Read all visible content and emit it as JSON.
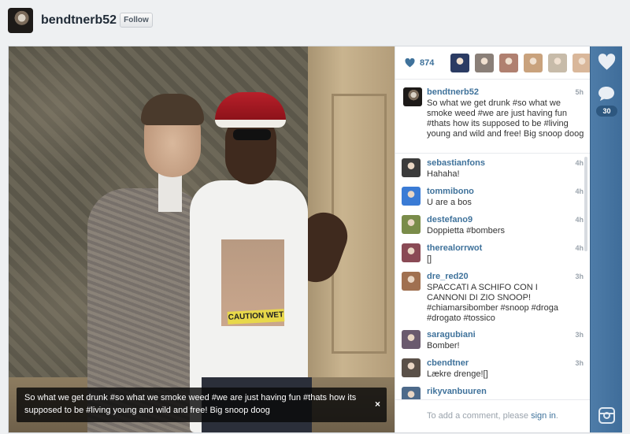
{
  "header": {
    "username": "bendtnerb52",
    "follow_label": "Follow"
  },
  "post": {
    "caption": "So what we get drunk #so what we smoke weed #we are just having fun #thats how its supposed to be #living young and wild and free! Big snoop doog",
    "photo_text": "CAUTION WET",
    "close_icon": "×"
  },
  "likes": {
    "count": "874",
    "avatar_colors": [
      "#2b3b63",
      "#8a7f78",
      "#b08070",
      "#c9a27d",
      "#c7bba9",
      "#d9b79a"
    ]
  },
  "author_comment": {
    "username": "bendtnerb52",
    "time": "5h",
    "text": "So what we get drunk #so what we smoke weed #we are just having fun #thats how its supposed to be #living young and wild and free! Big snoop doog"
  },
  "comments": [
    {
      "username": "sebastianfons",
      "time": "4h",
      "text": "Hahaha!",
      "color": "#3b3b3b"
    },
    {
      "username": "tommibono",
      "time": "4h",
      "text": "U are a bos",
      "color": "#3a7bd5"
    },
    {
      "username": "destefano9",
      "time": "4h",
      "text": "Doppietta #bombers",
      "color": "#7a8c4a"
    },
    {
      "username": "therealorrwot",
      "time": "4h",
      "text": "[]",
      "color": "#8a4a55"
    },
    {
      "username": "dre_red20",
      "time": "3h",
      "text": "SPACCATI A SCHIFO CON I CANNONI DI ZIO SNOOP! #chiamarsibomber #snoop #droga #drogato #tossico",
      "color": "#a07050"
    },
    {
      "username": "saragubiani",
      "time": "3h",
      "text": "Bomber!",
      "color": "#6a5a6e"
    },
    {
      "username": "cbendtner",
      "time": "3h",
      "text": "Lækre drenge![]",
      "color": "#5a5048"
    },
    {
      "username": "rikyvanbuuren",
      "time": "",
      "text": "",
      "color": "#4d6a8a"
    }
  ],
  "add_comment": {
    "prefix": "To add a comment, please ",
    "link": "sign in",
    "suffix": "."
  },
  "actions": {
    "comment_count": "30"
  }
}
